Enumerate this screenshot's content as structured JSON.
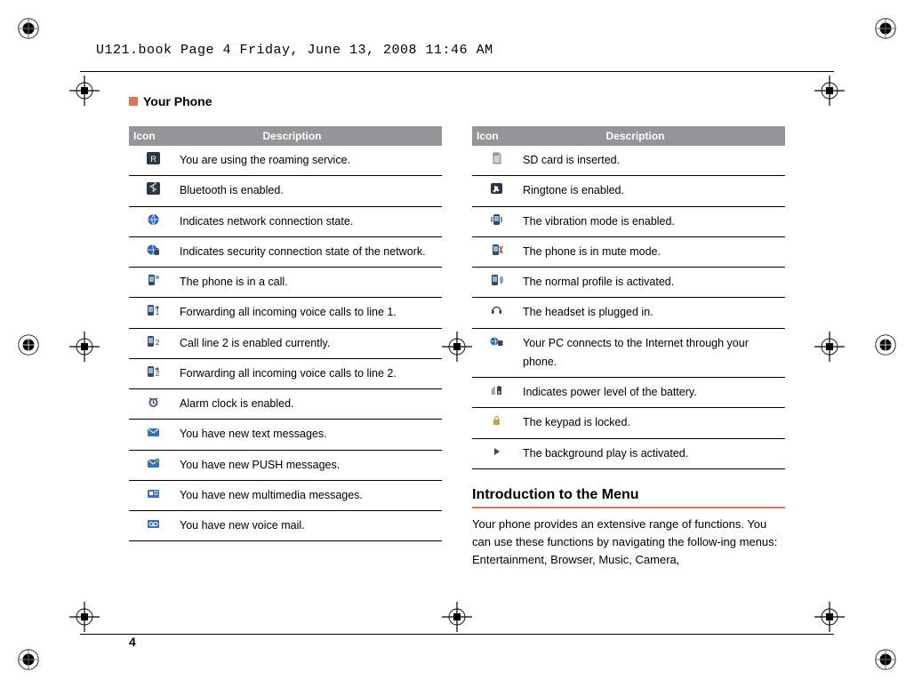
{
  "header_line": "U121.book  Page 4  Friday, June 13, 2008  11:46 AM",
  "section_title": "Your Phone",
  "table_header": {
    "icon": "Icon",
    "description": "Description"
  },
  "left_rows": [
    {
      "icon": "roaming-icon",
      "desc": "You are using the roaming service."
    },
    {
      "icon": "bluetooth-icon",
      "desc": "Bluetooth is enabled."
    },
    {
      "icon": "network-icon",
      "desc": "Indicates network connection state."
    },
    {
      "icon": "secure-network-icon",
      "desc": "Indicates security connection state of the network."
    },
    {
      "icon": "in-call-icon",
      "desc": "The phone is in a call."
    },
    {
      "icon": "forward-line1-icon",
      "desc": "Forwarding all incoming voice calls to line 1."
    },
    {
      "icon": "line2-icon",
      "desc": "Call line 2 is enabled currently."
    },
    {
      "icon": "forward-line2-icon",
      "desc": "Forwarding all incoming voice calls to line 2."
    },
    {
      "icon": "alarm-icon",
      "desc": "Alarm clock is enabled."
    },
    {
      "icon": "new-sms-icon",
      "desc": "You have new text messages."
    },
    {
      "icon": "push-msg-icon",
      "desc": "You have new PUSH messages."
    },
    {
      "icon": "mms-icon",
      "desc": "You have new multimedia messages."
    },
    {
      "icon": "voicemail-icon",
      "desc": "You have new voice mail."
    }
  ],
  "right_rows": [
    {
      "icon": "sd-card-icon",
      "desc": "SD card is inserted."
    },
    {
      "icon": "ringtone-icon",
      "desc": "Ringtone is enabled."
    },
    {
      "icon": "vibration-icon",
      "desc": "The vibration mode is enabled."
    },
    {
      "icon": "mute-icon",
      "desc": "The phone is in mute mode."
    },
    {
      "icon": "normal-profile-icon",
      "desc": "The normal profile is activated."
    },
    {
      "icon": "headset-icon",
      "desc": "The headset is plugged in."
    },
    {
      "icon": "pc-internet-icon",
      "desc": "Your PC connects to the Internet through your phone."
    },
    {
      "icon": "battery-icon",
      "desc": "Indicates power level of the battery."
    },
    {
      "icon": "keypad-locked-icon",
      "desc": "The keypad is locked."
    },
    {
      "icon": "background-play-icon",
      "desc": "The background play is activated."
    }
  ],
  "intro": {
    "heading": "Introduction to the Menu",
    "body": "Your phone provides an extensive range of functions. You can use these functions by navigating the follow-ing menus: Entertainment, Browser, Music, Camera,"
  },
  "page_number": "4"
}
